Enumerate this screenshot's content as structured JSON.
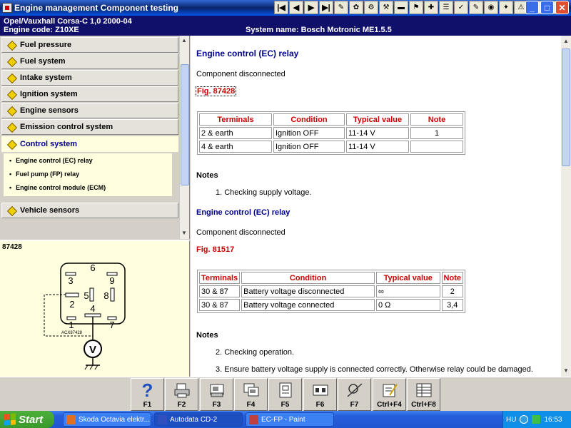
{
  "window": {
    "title": "Engine management Component testing"
  },
  "toolbar": {
    "buttons": [
      {
        "name": "first-record",
        "glyph": "|◀"
      },
      {
        "name": "previous-record",
        "glyph": "◀"
      },
      {
        "name": "next-record",
        "glyph": "▶"
      },
      {
        "name": "last-record",
        "glyph": "▶|"
      },
      {
        "name": "tool-1",
        "glyph": "✎"
      },
      {
        "name": "tool-2",
        "glyph": "✿"
      },
      {
        "name": "tool-3",
        "glyph": "⚙"
      },
      {
        "name": "tool-4",
        "glyph": "⚒"
      },
      {
        "name": "tool-5",
        "glyph": "▬"
      },
      {
        "name": "tool-6",
        "glyph": "⚑"
      },
      {
        "name": "tool-7",
        "glyph": "✚"
      },
      {
        "name": "tool-8",
        "glyph": "☰"
      },
      {
        "name": "tool-9",
        "glyph": "✓"
      },
      {
        "name": "tool-10",
        "glyph": "✎"
      },
      {
        "name": "tool-11",
        "glyph": "◉"
      },
      {
        "name": "tool-12",
        "glyph": "✦"
      },
      {
        "name": "tool-13",
        "glyph": "⚠"
      },
      {
        "name": "tool-14",
        "glyph": "✈"
      },
      {
        "name": "tool-15",
        "glyph": "✉"
      }
    ]
  },
  "vehicle": {
    "make_model": "Opel/Vauxhall    Corsa-C 1,0   2000-04",
    "engine_code": "Engine code: Z10XE",
    "system_name": "System name: Bosch Motronic ME1.5.5"
  },
  "sidebar": {
    "items": [
      {
        "label": "Fuel pressure"
      },
      {
        "label": "Fuel system"
      },
      {
        "label": "Intake system"
      },
      {
        "label": "Ignition system"
      },
      {
        "label": "Engine sensors"
      },
      {
        "label": "Emission control system"
      },
      {
        "label": "Control system"
      },
      {
        "label": "Vehicle sensors"
      }
    ],
    "subitems": [
      {
        "label": "Engine control (EC) relay"
      },
      {
        "label": "Fuel pump (FP) relay"
      },
      {
        "label": "Engine control module (ECM)"
      }
    ]
  },
  "diagram": {
    "fig_number": "87428",
    "pins": [
      "6",
      "3",
      "9",
      "2",
      "5",
      "8",
      "4",
      "1",
      "7"
    ],
    "meter_label": "V",
    "code": "ACX87428"
  },
  "content": {
    "section1": {
      "title": "Engine control (EC) relay",
      "status": "Component disconnected",
      "fig": "Fig. 87428",
      "headers": [
        "Terminals",
        "Condition",
        "Typical value",
        "Note"
      ],
      "rows": [
        [
          "2 & earth",
          "Ignition OFF",
          "11-14 V",
          "1"
        ],
        [
          "4 & earth",
          "Ignition OFF",
          "11-14 V",
          ""
        ]
      ],
      "notes_title": "Notes",
      "notes": [
        "1. Checking supply voltage."
      ]
    },
    "section2": {
      "title": "Engine control (EC) relay",
      "status": "Component disconnected",
      "fig": "Fig. 81517",
      "headers": [
        "Terminals",
        "Condition",
        "Typical value",
        "Note"
      ],
      "rows": [
        [
          "30 & 87",
          "Battery voltage disconnected",
          "∞",
          "2"
        ],
        [
          "30 & 87",
          "Battery voltage connected",
          "0 Ω",
          "3,4"
        ]
      ],
      "notes_title": "Notes",
      "notes": [
        "2. Checking operation.",
        "3. Ensure battery voltage supply is connected correctly. Otherwise relay could be damaged."
      ]
    }
  },
  "function_keys": [
    {
      "label": "F1",
      "icon": "help-icon"
    },
    {
      "label": "F2",
      "icon": "printer-icon"
    },
    {
      "label": "F3",
      "icon": "print-preview-icon"
    },
    {
      "label": "F4",
      "icon": "print-copy-icon"
    },
    {
      "label": "F5",
      "icon": "document-icon"
    },
    {
      "label": "F6",
      "icon": "component-icon"
    },
    {
      "label": "F7",
      "icon": "probe-icon"
    },
    {
      "label": "Ctrl+F4",
      "icon": "note-edit-icon"
    },
    {
      "label": "Ctrl+F8",
      "icon": "table-icon"
    }
  ],
  "taskbar": {
    "start_label": "Start",
    "tasks": [
      {
        "label": "Skoda Octavia elektr...",
        "color": "#e07020"
      },
      {
        "label": "Autodata CD-2",
        "color": "#3050c0"
      },
      {
        "label": "EC-FP - Paint",
        "color": "#c04040"
      }
    ],
    "language": "HU",
    "time": "16:53"
  },
  "colors": {
    "header_bg": "#10106a",
    "heading_blue": "#00008b",
    "fig_red": "#cc0000",
    "active_bg": "#ffffe0"
  }
}
